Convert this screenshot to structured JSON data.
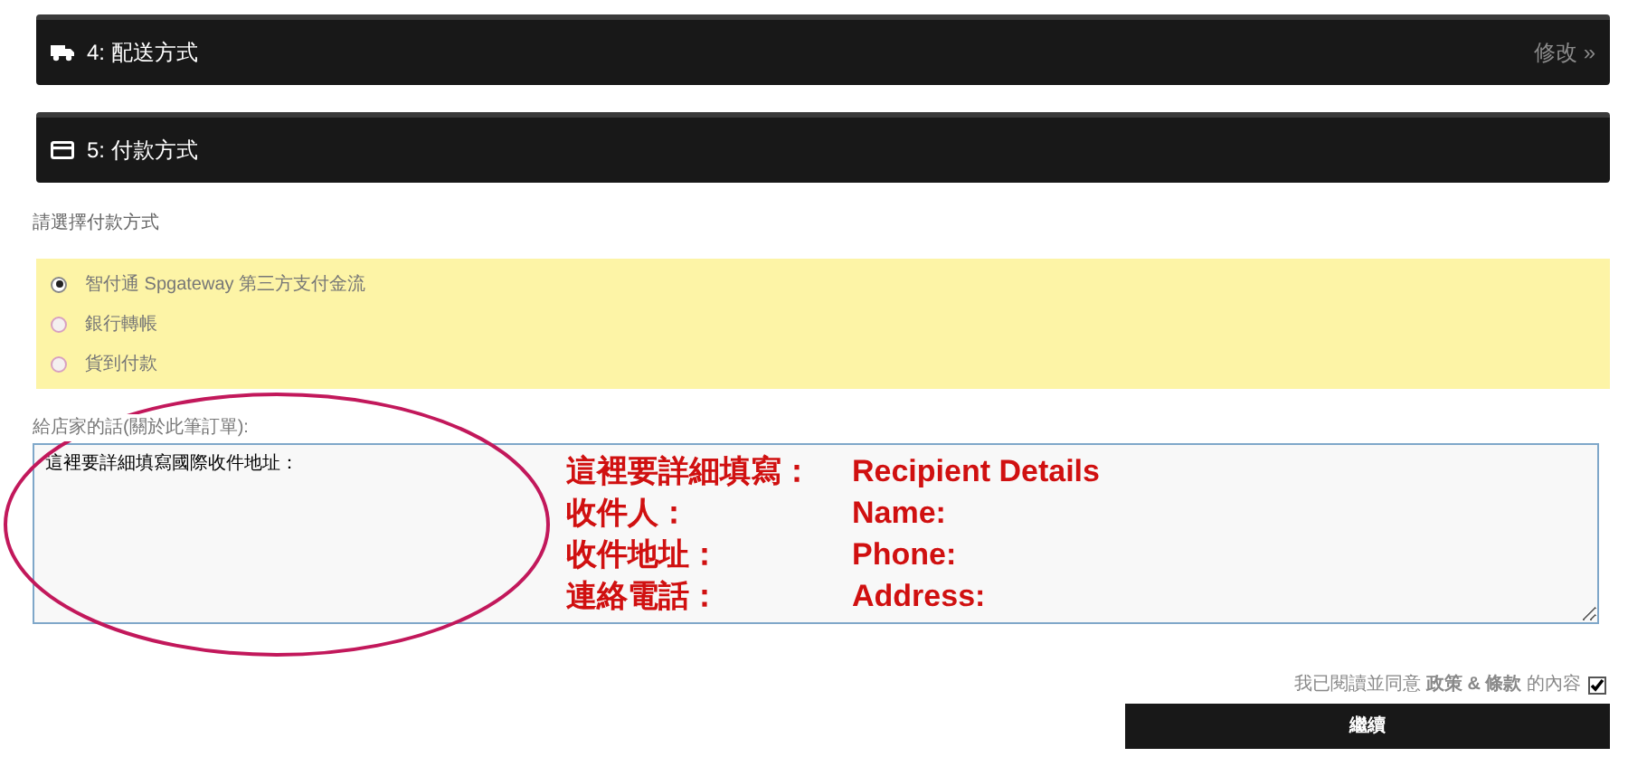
{
  "steps": [
    {
      "kind": "truck",
      "label": "4: 配送方式",
      "action": "修改 »"
    },
    {
      "kind": "card",
      "label": "5: 付款方式"
    }
  ],
  "payment": {
    "prompt": "請選擇付款方式",
    "options": [
      {
        "label": "智付通 Spgateway 第三方支付金流",
        "selected": true
      },
      {
        "label": "銀行轉帳",
        "selected": false
      },
      {
        "label": "貨到付款",
        "selected": false
      }
    ]
  },
  "message": {
    "label": "給店家的話(關於此筆訂單):",
    "value": "這裡要詳細填寫國際收件地址："
  },
  "annotation": {
    "rows": [
      {
        "left": "這裡要詳細填寫：",
        "right": "Recipient Details"
      },
      {
        "left": "收件人：",
        "right": "Name:"
      },
      {
        "left": "收件地址：",
        "right": "Phone:"
      },
      {
        "left": "連絡電話：",
        "right": "Address:"
      }
    ]
  },
  "agreement": {
    "text": "我已閱讀並同意 **政策 & 條款** 的內容",
    "checked": true
  },
  "continue_button": "繼續"
}
